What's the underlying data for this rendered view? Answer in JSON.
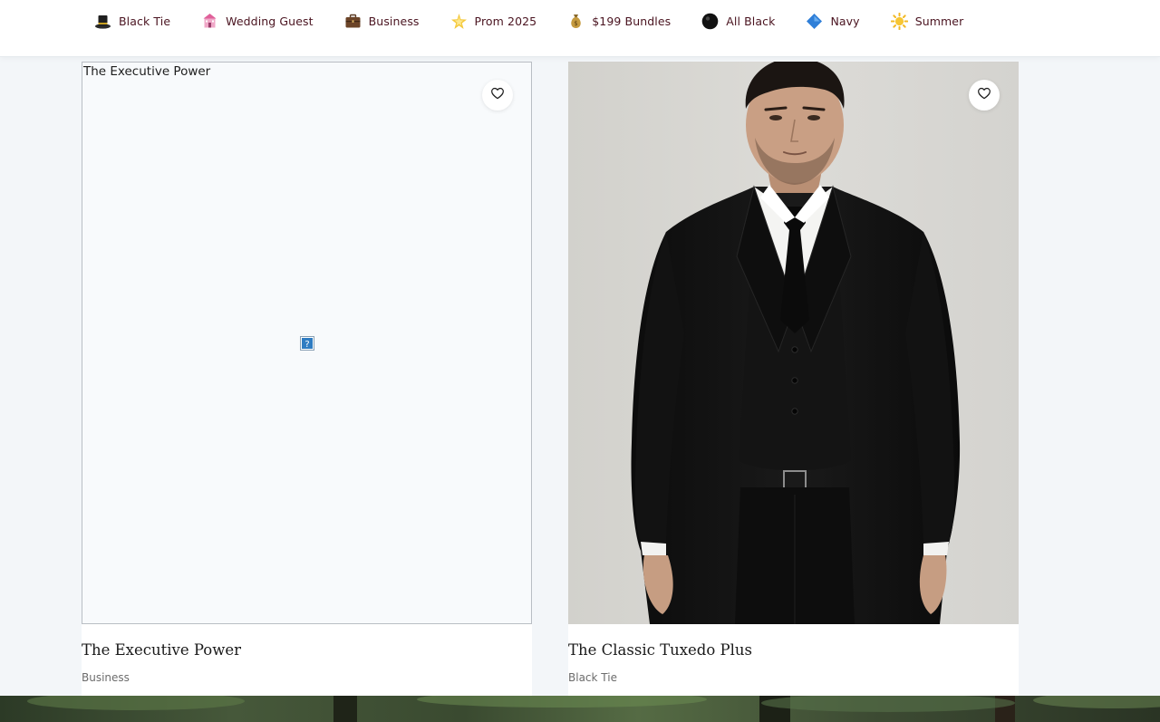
{
  "nav": {
    "items": [
      {
        "label": "Black Tie",
        "icon": "top-hat-icon"
      },
      {
        "label": "Wedding Guest",
        "icon": "wedding-chapel-icon"
      },
      {
        "label": "Business",
        "icon": "briefcase-icon"
      },
      {
        "label": "Prom 2025",
        "icon": "sparkle-star-icon"
      },
      {
        "label": "$199 Bundles",
        "icon": "money-bag-icon"
      },
      {
        "label": "All Black",
        "icon": "black-circle-icon"
      },
      {
        "label": "Navy",
        "icon": "blue-diamond-icon"
      },
      {
        "label": "Summer",
        "icon": "sun-icon"
      }
    ]
  },
  "products": [
    {
      "title": "The Executive Power",
      "category": "Business",
      "image_alt": "The Executive Power",
      "image_state": "broken"
    },
    {
      "title": "The Classic Tuxedo Plus",
      "category": "Black Tie",
      "image_state": "loaded"
    }
  ],
  "colors": {
    "nav_text": "#4a1420",
    "page_bg": "#f3f6f9",
    "card_bg": "#ffffff"
  }
}
